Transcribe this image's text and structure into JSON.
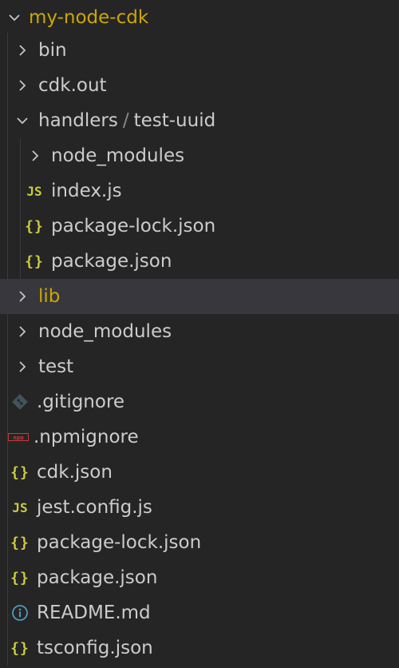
{
  "explorer": {
    "root": {
      "label": "my-node-cdk",
      "expanded": true
    },
    "items": [
      {
        "label": "bin",
        "type": "folder",
        "expanded": false
      },
      {
        "label": "cdk.out",
        "type": "folder",
        "expanded": false
      },
      {
        "label": "handlers",
        "compact_child": "test-uuid",
        "separator": "/",
        "type": "folder",
        "expanded": true
      },
      {
        "label": "node_modules",
        "type": "folder",
        "expanded": false
      },
      {
        "label": "index.js",
        "type": "js",
        "icon_text": "JS"
      },
      {
        "label": "package-lock.json",
        "type": "json",
        "icon_text": "{}"
      },
      {
        "label": "package.json",
        "type": "json",
        "icon_text": "{}"
      },
      {
        "label": "lib",
        "type": "folder",
        "expanded": false,
        "selected": true
      },
      {
        "label": "node_modules",
        "type": "folder",
        "expanded": false
      },
      {
        "label": "test",
        "type": "folder",
        "expanded": false
      },
      {
        "label": ".gitignore",
        "type": "git"
      },
      {
        "label": ".npmignore",
        "type": "npm",
        "icon_text": "npm"
      },
      {
        "label": "cdk.json",
        "type": "json",
        "icon_text": "{}"
      },
      {
        "label": "jest.config.js",
        "type": "js",
        "icon_text": "JS"
      },
      {
        "label": "package-lock.json",
        "type": "json",
        "icon_text": "{}"
      },
      {
        "label": "package.json",
        "type": "json",
        "icon_text": "{}"
      },
      {
        "label": "README.md",
        "type": "info"
      },
      {
        "label": "tsconfig.json",
        "type": "json",
        "icon_text": "{}"
      }
    ]
  },
  "colors": {
    "background": "#252526",
    "selected_row": "#37373d",
    "text": "#cccccc",
    "modified_folder": "#cca700",
    "json_js_icon": "#cbcb41",
    "npm_icon": "#cb3837",
    "git_icon": "#41535b",
    "info_icon": "#519aba"
  }
}
